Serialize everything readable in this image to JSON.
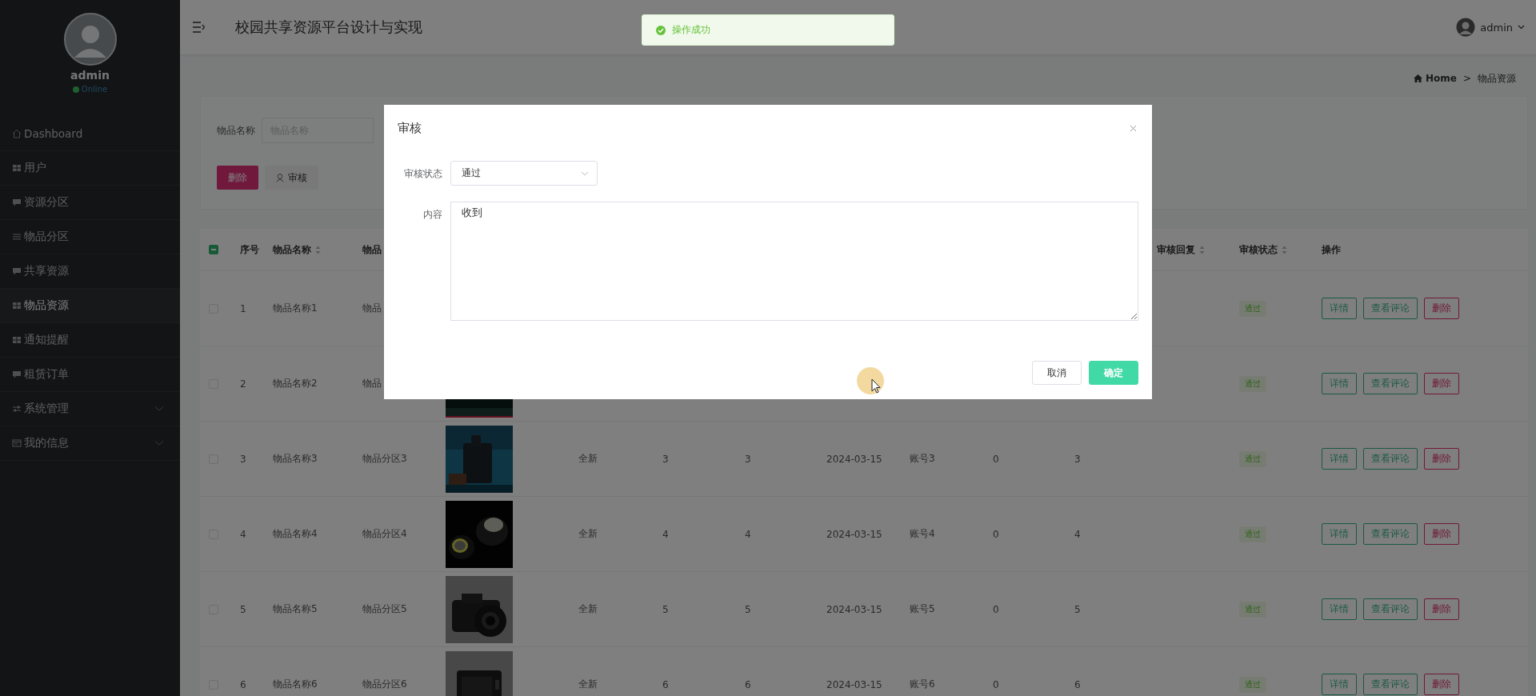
{
  "sidebar": {
    "user": {
      "name": "admin",
      "status": "Online",
      "online": true
    },
    "menu": [
      {
        "label": "Dashboard",
        "kind": "home",
        "selected": false,
        "submenu": false
      },
      {
        "label": "用户",
        "kind": "grid",
        "selected": false,
        "submenu": false
      },
      {
        "label": "资源分区",
        "kind": "bubble",
        "selected": false,
        "submenu": false
      },
      {
        "label": "物品分区",
        "kind": "lines",
        "selected": false,
        "submenu": false
      },
      {
        "label": "共享资源",
        "kind": "bubble",
        "selected": false,
        "submenu": false
      },
      {
        "label": "物品资源",
        "kind": "grid",
        "selected": true,
        "submenu": false
      },
      {
        "label": "通知提醒",
        "kind": "grid",
        "selected": false,
        "submenu": false
      },
      {
        "label": "租赁订单",
        "kind": "bubble",
        "selected": false,
        "submenu": false
      },
      {
        "label": "系统管理",
        "kind": "sliders",
        "selected": false,
        "submenu": true
      },
      {
        "label": "我的信息",
        "kind": "window",
        "selected": false,
        "submenu": true
      }
    ]
  },
  "header": {
    "title": "校园共享资源平台设计与实现",
    "user": "admin"
  },
  "toast": {
    "message": "操作成功"
  },
  "breadcrumb": {
    "items": [
      {
        "label": "Home",
        "kind": "home"
      },
      {
        "label": "物品资源",
        "kind": "page"
      }
    ],
    "separator": ">"
  },
  "search": {
    "label": "物品名称",
    "placeholder": "物品名称"
  },
  "actions": [
    {
      "label": "删除",
      "kind": "danger"
    },
    {
      "label": "审核",
      "kind": "plain"
    }
  ],
  "table": {
    "columns": [
      {
        "kind": "checkbox",
        "indeterminate": true
      },
      {
        "label": "序号"
      },
      {
        "label": "物品名称",
        "sortable": true
      },
      {
        "label": "物品"
      },
      {},
      {},
      {},
      {},
      {},
      {},
      {},
      {},
      {
        "label": "审核回复",
        "sortable": true
      },
      {
        "label": "审核状态",
        "sortable": true
      },
      {
        "label": "操作"
      }
    ],
    "rows": [
      {
        "checked": false,
        "no": "1",
        "name": "物品名称1",
        "category": "物品",
        "status": {
          "label": "通过",
          "kind": "success"
        },
        "actions": [
          {
            "label": "详情",
            "kind": "primary"
          },
          {
            "label": "查看评论",
            "kind": "primary"
          },
          {
            "label": "删除",
            "kind": "danger"
          }
        ]
      },
      {
        "checked": false,
        "no": "2",
        "name": "物品名称2",
        "category": "物品",
        "status": {
          "label": "通过",
          "kind": "success"
        },
        "actions": [
          {
            "label": "详情",
            "kind": "primary"
          },
          {
            "label": "查看评论",
            "kind": "primary"
          },
          {
            "label": "删除",
            "kind": "danger"
          }
        ]
      },
      {
        "checked": false,
        "no": "3",
        "name": "物品名称3",
        "category": "物品分区3",
        "column_6": "全新",
        "column_7": "3",
        "column_8": "3",
        "column_9": "2024-03-15",
        "column_10": "账号3",
        "column_11": "0",
        "column_12": "3",
        "status": {
          "label": "通过",
          "kind": "success"
        },
        "actions": [
          {
            "label": "详情",
            "kind": "primary"
          },
          {
            "label": "查看评论",
            "kind": "primary"
          },
          {
            "label": "删除",
            "kind": "danger"
          }
        ]
      },
      {
        "checked": false,
        "no": "4",
        "name": "物品名称4",
        "category": "物品分区4",
        "column_6": "全新",
        "column_7": "4",
        "column_8": "4",
        "column_9": "2024-03-15",
        "column_10": "账号4",
        "column_11": "0",
        "column_12": "4",
        "status": {
          "label": "通过",
          "kind": "success"
        },
        "actions": [
          {
            "label": "详情",
            "kind": "primary"
          },
          {
            "label": "查看评论",
            "kind": "primary"
          },
          {
            "label": "删除",
            "kind": "danger"
          }
        ]
      },
      {
        "checked": false,
        "no": "5",
        "name": "物品名称5",
        "category": "物品分区5",
        "column_6": "全新",
        "column_7": "5",
        "column_8": "5",
        "column_9": "2024-03-15",
        "column_10": "账号5",
        "column_11": "0",
        "column_12": "5",
        "status": {
          "label": "通过",
          "kind": "success"
        },
        "actions": [
          {
            "label": "详情",
            "kind": "primary"
          },
          {
            "label": "查看评论",
            "kind": "primary"
          },
          {
            "label": "删除",
            "kind": "danger"
          }
        ]
      },
      {
        "checked": false,
        "no": "6",
        "name": "物品名称6",
        "category": "物品分区6",
        "column_6": "全新",
        "column_7": "6",
        "column_8": "6",
        "column_9": "2024-03-15",
        "column_10": "账号6",
        "column_11": "0",
        "column_12": "6",
        "status": {
          "label": "通过",
          "kind": "success"
        },
        "actions": [
          {
            "label": "详情",
            "kind": "primary"
          },
          {
            "label": "查看评论",
            "kind": "primary"
          },
          {
            "label": "删除",
            "kind": "danger"
          }
        ]
      }
    ]
  },
  "dialog": {
    "title": "审核",
    "fields": [
      {
        "label": "审核状态",
        "kind": "select",
        "value": "通过"
      },
      {
        "label": "内容",
        "kind": "textarea",
        "value": "收到"
      }
    ],
    "buttons": [
      {
        "label": "取消",
        "kind": "default"
      },
      {
        "label": "确定",
        "kind": "primary"
      }
    ]
  }
}
